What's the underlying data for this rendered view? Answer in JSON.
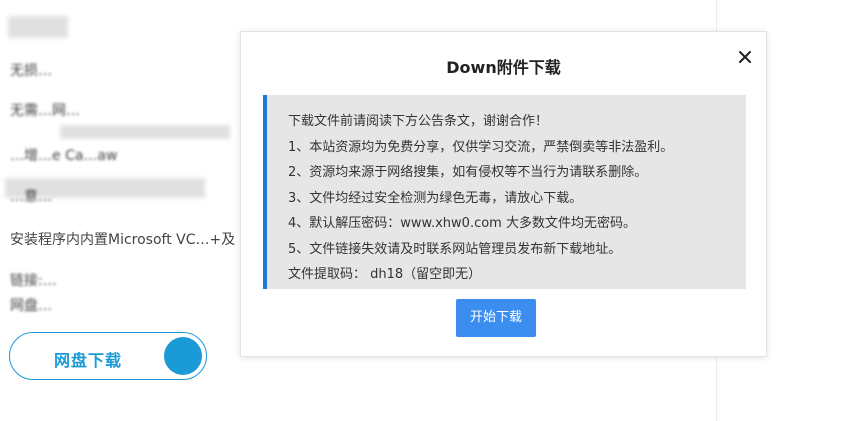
{
  "background": {
    "lines": [
      "无损…",
      "无需…网…",
      "…增…e Ca…aw",
      "…意…",
      "安装程序内内置Microsoft VC…+及",
      "链接:…",
      "网盘…"
    ],
    "netdisk_button_label": "网盘下载"
  },
  "modal": {
    "title": "Down附件下载",
    "close_icon": "close-icon",
    "notice_lines": [
      "下载文件前请阅读下方公告条文，谢谢合作！",
      "1、本站资源均为免费分享，仅供学习交流，严禁倒卖等非法盈利。",
      "2、资源均来源于网络搜集，如有侵权等不当行为请联系删除。",
      "3、文件均经过安全检测为绿色无毒，请放心下载。",
      "4、默认解压密码：www.xhw0.com 大多数文件均无密码。",
      "5、文件链接失效请及时联系网站管理员发布新下载地址。",
      "文件提取码： dh18（留空即无）"
    ],
    "start_button_label": "开始下载"
  },
  "colors": {
    "accent_blue": "#3b8ef0",
    "notice_border": "#1e78d6",
    "netdisk_blue": "#1a9ad6",
    "notice_bg": "#e6e6e6"
  }
}
